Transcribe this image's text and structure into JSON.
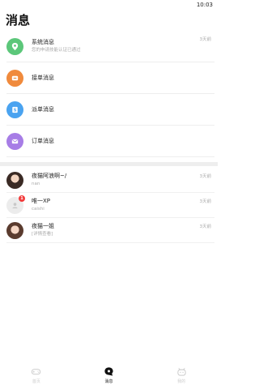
{
  "status_bar": {
    "time": "10:03"
  },
  "page_title": "消息",
  "system_messages": [
    {
      "title": "系统消息",
      "subtitle": "您的申请技能认证已通过",
      "time": "3天前",
      "icon": "location-pin-icon",
      "color": "#5cc77a"
    },
    {
      "title": "接单消息",
      "subtitle": "",
      "time": "",
      "icon": "order-accept-icon",
      "color": "#f08a3c"
    },
    {
      "title": "派单消息",
      "subtitle": "",
      "time": "",
      "icon": "dispatch-icon",
      "color": "#4aa3f0"
    },
    {
      "title": "订单消息",
      "subtitle": "",
      "time": "",
      "icon": "envelope-icon",
      "color": "#a77de6"
    }
  ],
  "chats": [
    {
      "name": "夜猫阿浪啊~/",
      "preview": "nan",
      "time": "3天前",
      "badge": ""
    },
    {
      "name": "唯一XP",
      "preview": "caishi",
      "time": "3天前",
      "badge": "1"
    },
    {
      "name": "夜猫一姐",
      "preview": "[详情查看]",
      "time": "3天前",
      "badge": ""
    }
  ],
  "tabbar": {
    "tabs": [
      {
        "label": "首页",
        "icon": "gamepad-icon",
        "active": false
      },
      {
        "label": "消息",
        "icon": "chat-bubble-icon",
        "active": true
      },
      {
        "label": "我的",
        "icon": "profile-icon",
        "active": false
      }
    ]
  },
  "colors": {
    "accent": "#111111",
    "badge": "#f23c3c",
    "divider": "#eeeeee"
  }
}
